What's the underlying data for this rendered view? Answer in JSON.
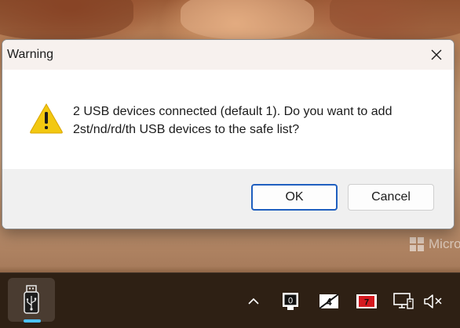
{
  "dialog": {
    "title": "Warning",
    "icon": "warning-triangle-icon",
    "message_line1": "2 USB devices connected (default 1). Do you want to add",
    "message_line2": "2st/nd/rd/th USB devices to the safe list?",
    "ok_label": "OK",
    "cancel_label": "Cancel",
    "close_icon": "close-icon"
  },
  "desktop": {
    "watermark_text": "Micro"
  },
  "taskbar": {
    "apps": [
      {
        "name": "usb-app",
        "icon": "usb-icon",
        "active": true
      }
    ],
    "tray": [
      {
        "icon": "chevron-up-icon"
      },
      {
        "icon": "usb-device-counter-icon",
        "text": "0"
      },
      {
        "icon": "usb-disabled-icon",
        "text": "4"
      },
      {
        "icon": "red-status-icon",
        "text": "7"
      },
      {
        "icon": "network-monitor-icon"
      },
      {
        "icon": "speaker-muted-icon"
      }
    ]
  },
  "colors": {
    "accent": "#1f5fbf",
    "taskbar": "#2e2014",
    "taskbar_indicator": "#4cc2ff",
    "warning_yellow": "#f2c811",
    "tray_red": "#d4191f"
  }
}
